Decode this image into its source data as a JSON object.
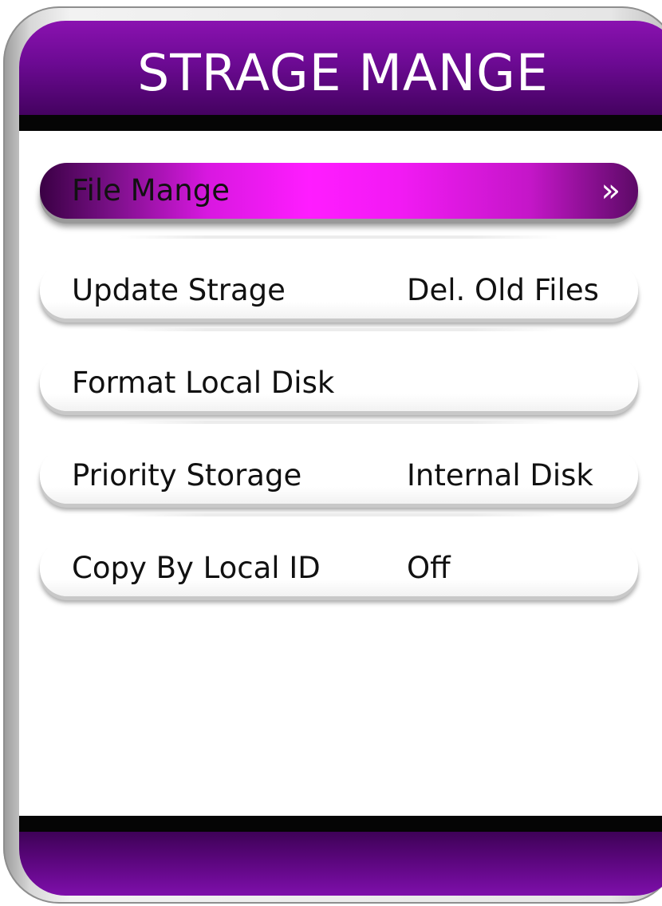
{
  "header": {
    "title": "STRAGE MANGE"
  },
  "menu": {
    "items": [
      {
        "label": "File Mange",
        "value": "",
        "selected": true,
        "arrow": "»"
      },
      {
        "label": "Update Strage",
        "value": "Del. Old Files",
        "selected": false
      },
      {
        "label": "Format Local Disk",
        "value": "",
        "selected": false
      },
      {
        "label": "Priority Storage",
        "value": "Internal Disk",
        "selected": false
      },
      {
        "label": "Copy By Local ID",
        "value": "Off",
        "selected": false
      }
    ]
  },
  "icons": {
    "selected_arrow": "double-chevron-right-icon"
  },
  "colors": {
    "header_purple": "#6c0a93",
    "highlight_magenta": "#ff1cff",
    "bar_black": "#050505"
  }
}
